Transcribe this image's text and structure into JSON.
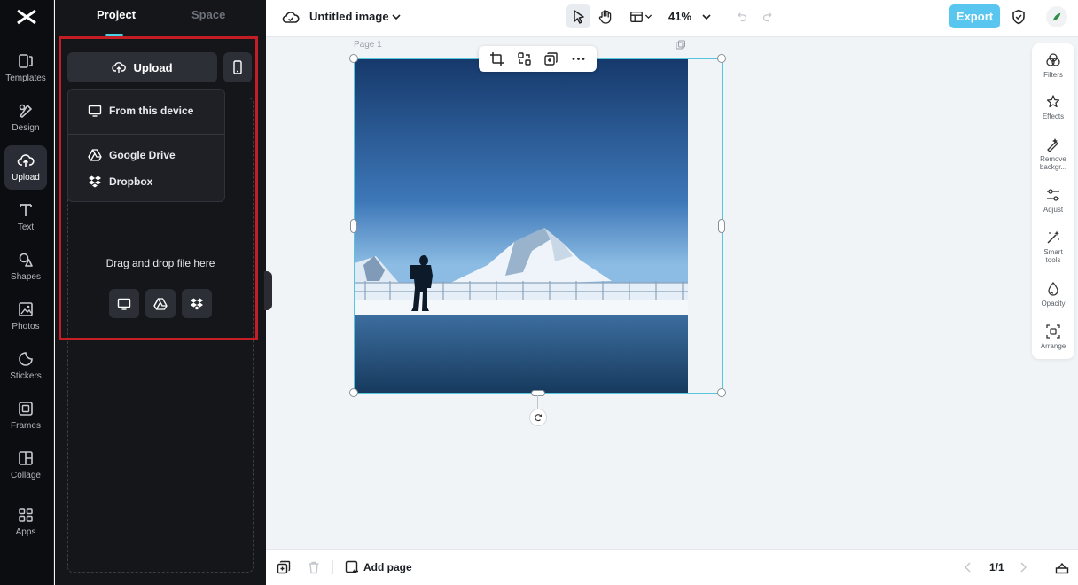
{
  "rail": {
    "items": [
      {
        "label": "Templates",
        "icon": "templates-icon"
      },
      {
        "label": "Design",
        "icon": "design-icon"
      },
      {
        "label": "Upload",
        "icon": "upload-cloud-icon",
        "active": true
      },
      {
        "label": "Text",
        "icon": "text-icon"
      },
      {
        "label": "Shapes",
        "icon": "shapes-icon"
      },
      {
        "label": "Photos",
        "icon": "photos-icon"
      },
      {
        "label": "Stickers",
        "icon": "stickers-icon"
      },
      {
        "label": "Frames",
        "icon": "frames-icon"
      },
      {
        "label": "Collage",
        "icon": "collage-icon"
      },
      {
        "label": "Apps",
        "icon": "apps-icon"
      }
    ]
  },
  "panel": {
    "tabs": [
      "Project",
      "Space"
    ],
    "upload_label": "Upload",
    "menu": {
      "from_device": "From this device",
      "google_drive": "Google Drive",
      "dropbox": "Dropbox"
    },
    "drag_text": "Drag and drop file here"
  },
  "topbar": {
    "title": "Untitled image",
    "zoom": "41%",
    "export_label": "Export"
  },
  "canvas": {
    "page_label": "Page 1"
  },
  "right_tools": [
    {
      "label": "Filters"
    },
    {
      "label": "Effects"
    },
    {
      "label": "Remove backgr..."
    },
    {
      "label": "Adjust"
    },
    {
      "label": "Smart tools"
    },
    {
      "label": "Opacity"
    },
    {
      "label": "Arrange"
    }
  ],
  "bottombar": {
    "add_page": "Add page",
    "page_count": "1/1"
  },
  "colors": {
    "accent": "#4bd0e6",
    "export": "#58c6ee",
    "highlight": "#c21e23"
  }
}
